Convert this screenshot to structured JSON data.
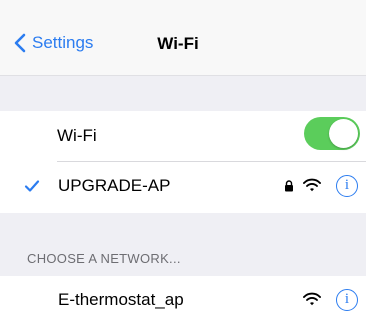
{
  "navbar": {
    "back_label": "Settings",
    "title": "Wi-Fi"
  },
  "wifi_toggle": {
    "label": "Wi-Fi",
    "on": true,
    "on_color": "#5bcd5b"
  },
  "connected_network": {
    "name": "UPGRADE-AP",
    "secured": true,
    "icons": [
      "checkmark-icon",
      "lock-icon",
      "wifi-signal-icon",
      "info-icon"
    ]
  },
  "section_header": "CHOOSE A NETWORK...",
  "networks": [
    {
      "name": "E-thermostat_ap",
      "secured": false,
      "icons": [
        "wifi-signal-icon",
        "info-icon"
      ]
    }
  ],
  "accent_color": "#2b7cf0",
  "info_glyph": "i"
}
